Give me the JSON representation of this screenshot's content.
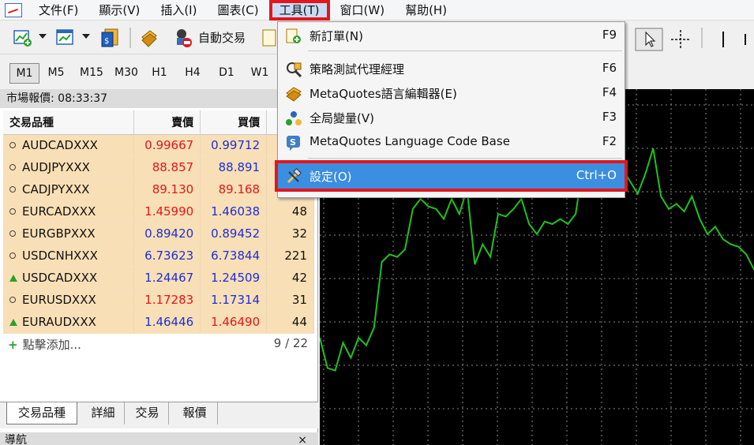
{
  "menubar": {
    "items": [
      "文件(F)",
      "顯示(V)",
      "插入(I)",
      "圖表(C)",
      "工具(T)",
      "窗口(W)",
      "幫助(H)"
    ],
    "active_index": 4
  },
  "toolbar": {
    "auto_trade_label": "自動交易"
  },
  "timeframes": {
    "items": [
      "M1",
      "M5",
      "M15",
      "M30",
      "H1",
      "H4",
      "D1",
      "W1"
    ],
    "selected": "M1"
  },
  "market_watch": {
    "title": "市場報價: 08:33:37",
    "columns": [
      "交易品種",
      "賣價",
      "買價"
    ],
    "rows": [
      {
        "symbol": "AUDCADXXX",
        "bid": "0.99667",
        "ask": "0.99712",
        "spread": "",
        "bid_color": "red",
        "ask_color": "blue",
        "icon": "bullet"
      },
      {
        "symbol": "AUDJPYXXX",
        "bid": "88.857",
        "ask": "88.891",
        "spread": "",
        "bid_color": "red",
        "ask_color": "blue",
        "icon": "bullet"
      },
      {
        "symbol": "CADJPYXXX",
        "bid": "89.130",
        "ask": "89.168",
        "spread": "",
        "bid_color": "red",
        "ask_color": "red",
        "icon": "bullet"
      },
      {
        "symbol": "EURCADXXX",
        "bid": "1.45990",
        "ask": "1.46038",
        "spread": "48",
        "bid_color": "red",
        "ask_color": "blue",
        "icon": "bullet"
      },
      {
        "symbol": "EURGBPXXX",
        "bid": "0.89420",
        "ask": "0.89452",
        "spread": "32",
        "bid_color": "blue",
        "ask_color": "blue",
        "icon": "bullet"
      },
      {
        "symbol": "USDCNHXXX",
        "bid": "6.73623",
        "ask": "6.73844",
        "spread": "221",
        "bid_color": "blue",
        "ask_color": "blue",
        "icon": "bullet"
      },
      {
        "symbol": "USDCADXXX",
        "bid": "1.24467",
        "ask": "1.24509",
        "spread": "42",
        "bid_color": "blue",
        "ask_color": "blue",
        "icon": "up-arrow"
      },
      {
        "symbol": "EURUSDXXX",
        "bid": "1.17283",
        "ask": "1.17314",
        "spread": "31",
        "bid_color": "red",
        "ask_color": "blue",
        "icon": "bullet"
      },
      {
        "symbol": "EURAUDXXX",
        "bid": "1.46446",
        "ask": "1.46490",
        "spread": "44",
        "bid_color": "blue",
        "ask_color": "red",
        "icon": "up-arrow"
      }
    ],
    "add_label": "點擊添加...",
    "count": "9 / 22",
    "tabs": [
      "交易品種",
      "詳細",
      "交易",
      "報價"
    ],
    "selected_tab": 0
  },
  "navigator": {
    "title": "導航",
    "close": "×"
  },
  "dropdown": {
    "items": [
      {
        "label": "新訂單(N)",
        "key": "F9",
        "icon": "new-order-icon"
      },
      {
        "label": "策略測試代理經理",
        "key": "F6",
        "icon": "strategy-tester-icon"
      },
      {
        "label": "MetaQuotes語言編輯器(E)",
        "key": "F4",
        "icon": "metaeditor-icon"
      },
      {
        "label": "全局變量(V)",
        "key": "F3",
        "icon": "global-variables-icon"
      },
      {
        "label": "MetaQuotes Language Code Base",
        "key": "F2",
        "icon": "codebase-icon"
      },
      {
        "label": "設定(O)",
        "key": "Ctrl+O",
        "icon": "settings-icon"
      }
    ],
    "highlighted_index": 5
  },
  "colors": {
    "bid_red": "#e3161d",
    "ask_blue": "#1c2fd6",
    "row_bg": "#f9dfb6",
    "highlight": "#3b8ee0",
    "annotation_red": "#e3161d",
    "chart_line": "#1fc21f",
    "chart_bg": "#000000"
  },
  "chart_data": {
    "type": "line",
    "series": [
      {
        "values": [
          0.25,
          0.13,
          0.12,
          0.23,
          0.17,
          0.25,
          0.22,
          0.29,
          0.55,
          0.58,
          0.57,
          0.6,
          0.76,
          0.8,
          0.77,
          0.76,
          0.72,
          0.8,
          0.74,
          0.84,
          0.54,
          0.62,
          0.57,
          0.74,
          0.73,
          0.76,
          0.8,
          0.7,
          0.66,
          0.71,
          0.7,
          0.72,
          0.7,
          0.74,
          0.94,
          0.96,
          0.95,
          0.97,
          0.85,
          0.92,
          0.87,
          0.82,
          0.9,
          1.0,
          0.81,
          0.76,
          0.78,
          0.75,
          0.81,
          0.72,
          0.66,
          0.69,
          0.64,
          0.62,
          0.61,
          0.58,
          0.52
        ]
      }
    ],
    "grid": true
  }
}
